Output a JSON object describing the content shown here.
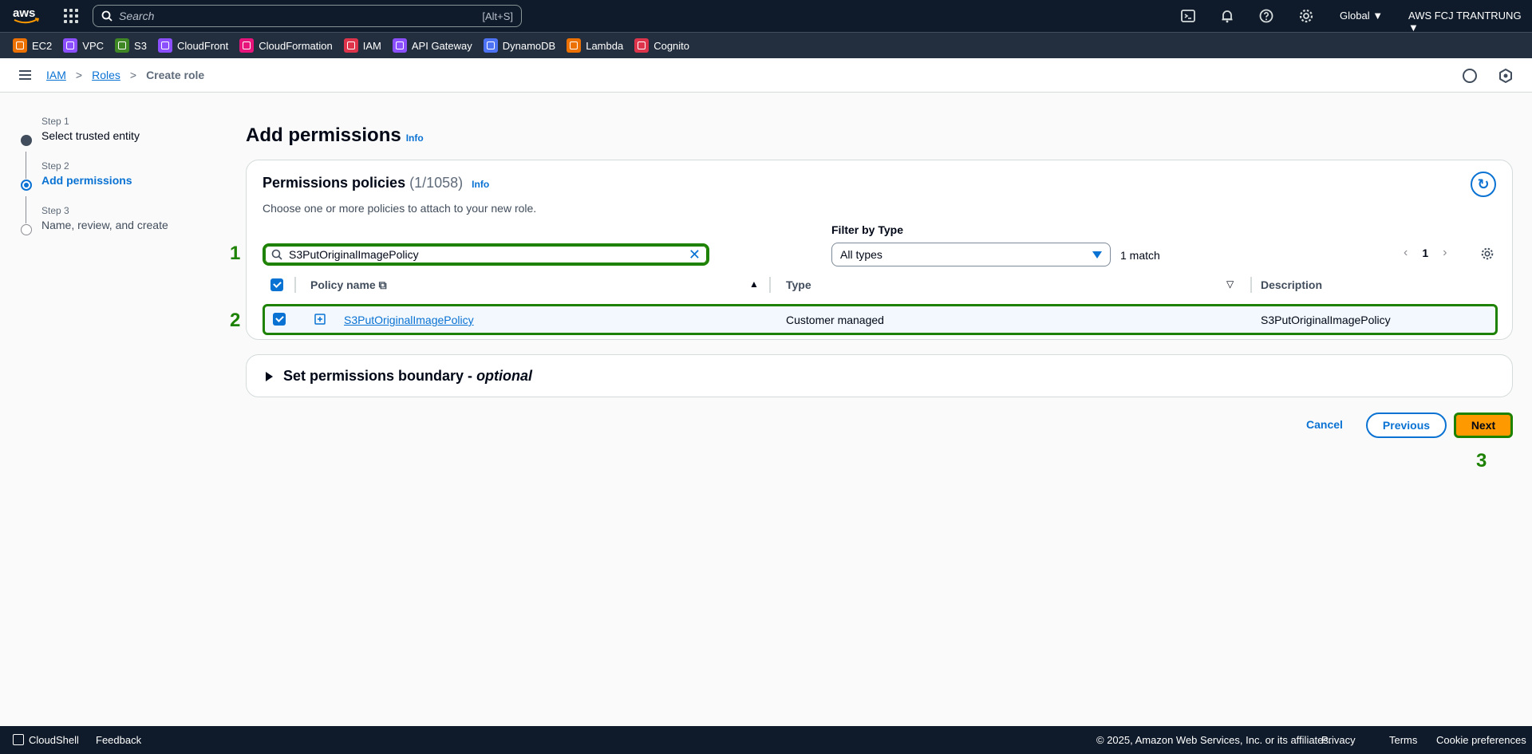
{
  "topnav": {
    "logo": "aws",
    "search_placeholder": "Search",
    "search_shortcut": "[Alt+S]",
    "region": "Global",
    "account": "AWS FCJ TRANTRUNG",
    "icons": [
      "cloudshell-icon",
      "bell-icon",
      "help-icon",
      "gear-icon"
    ]
  },
  "favorites": [
    {
      "label": "EC2",
      "color": "#ed7100"
    },
    {
      "label": "VPC",
      "color": "#8c4fff"
    },
    {
      "label": "S3",
      "color": "#3f8624"
    },
    {
      "label": "CloudFront",
      "color": "#8c4fff"
    },
    {
      "label": "CloudFormation",
      "color": "#e7157b"
    },
    {
      "label": "IAM",
      "color": "#dd344c"
    },
    {
      "label": "API Gateway",
      "color": "#8c4fff"
    },
    {
      "label": "DynamoDB",
      "color": "#4d72f3"
    },
    {
      "label": "Lambda",
      "color": "#ed7100"
    },
    {
      "label": "Cognito",
      "color": "#dd344c"
    }
  ],
  "breadcrumb": {
    "items": [
      "IAM",
      "Roles"
    ],
    "current": "Create role"
  },
  "steps": [
    {
      "label": "Step 1",
      "name": "Select trusted entity"
    },
    {
      "label": "Step 2",
      "name": "Add permissions"
    },
    {
      "label": "Step 3",
      "name": "Name, review, and create"
    }
  ],
  "main": {
    "title": "Add permissions",
    "info": "Info",
    "card": {
      "title": "Permissions policies",
      "count": "(1/1058)",
      "info": "Info",
      "description": "Choose one or more policies to attach to your new role.",
      "filter_label": "Filter by Type",
      "search_value": "S3PutOriginalImagePolicy",
      "filter_value": "All types",
      "match": "1 match",
      "page": "1",
      "columns": [
        "Policy name",
        "Type",
        "Description"
      ],
      "rows": [
        {
          "name": "S3PutOriginalImagePolicy",
          "type": "Customer managed",
          "description": "S3PutOriginalImagePolicy",
          "selected": true
        }
      ]
    },
    "boundary": {
      "title": "Set permissions boundary - ",
      "optional": "optional"
    },
    "buttons": {
      "cancel": "Cancel",
      "previous": "Previous",
      "next": "Next"
    },
    "markers": [
      "1",
      "2",
      "3"
    ]
  },
  "footer": {
    "cloudshell": "CloudShell",
    "feedback": "Feedback",
    "copyright": "© 2025, Amazon Web Services, Inc. or its affiliates.",
    "privacy": "Privacy",
    "terms": "Terms",
    "cookies": "Cookie preferences"
  }
}
